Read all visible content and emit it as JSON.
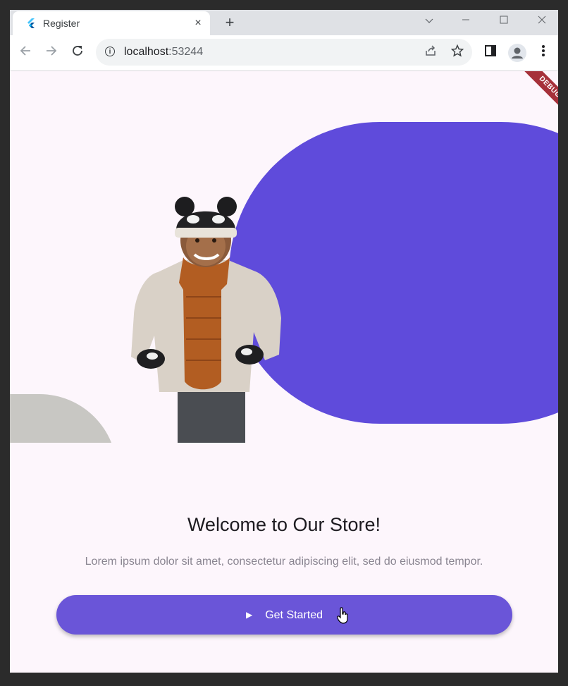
{
  "browser": {
    "tab_title": "Register",
    "tab_close": "×",
    "new_tab": "+",
    "url_host": "localhost",
    "url_port": ":53244"
  },
  "page": {
    "debug_label": "DEBUG",
    "headline": "Welcome to Our Store!",
    "subtext": "Lorem ipsum dolor sit amet, consectetur adipiscing elit, sed do eiusmod tempor.",
    "cta_label": "Get Started"
  },
  "colors": {
    "accent": "#5f4bdb",
    "button": "#6a55d8",
    "background": "#fdf6fc",
    "debug_banner": "#a6313a"
  },
  "icons": [
    "flutter-icon",
    "back-icon",
    "forward-icon",
    "reload-icon",
    "info-icon",
    "share-icon",
    "star-icon",
    "side-panel-icon",
    "profile-icon",
    "menu-icon",
    "play-icon",
    "hand-cursor-icon"
  ]
}
